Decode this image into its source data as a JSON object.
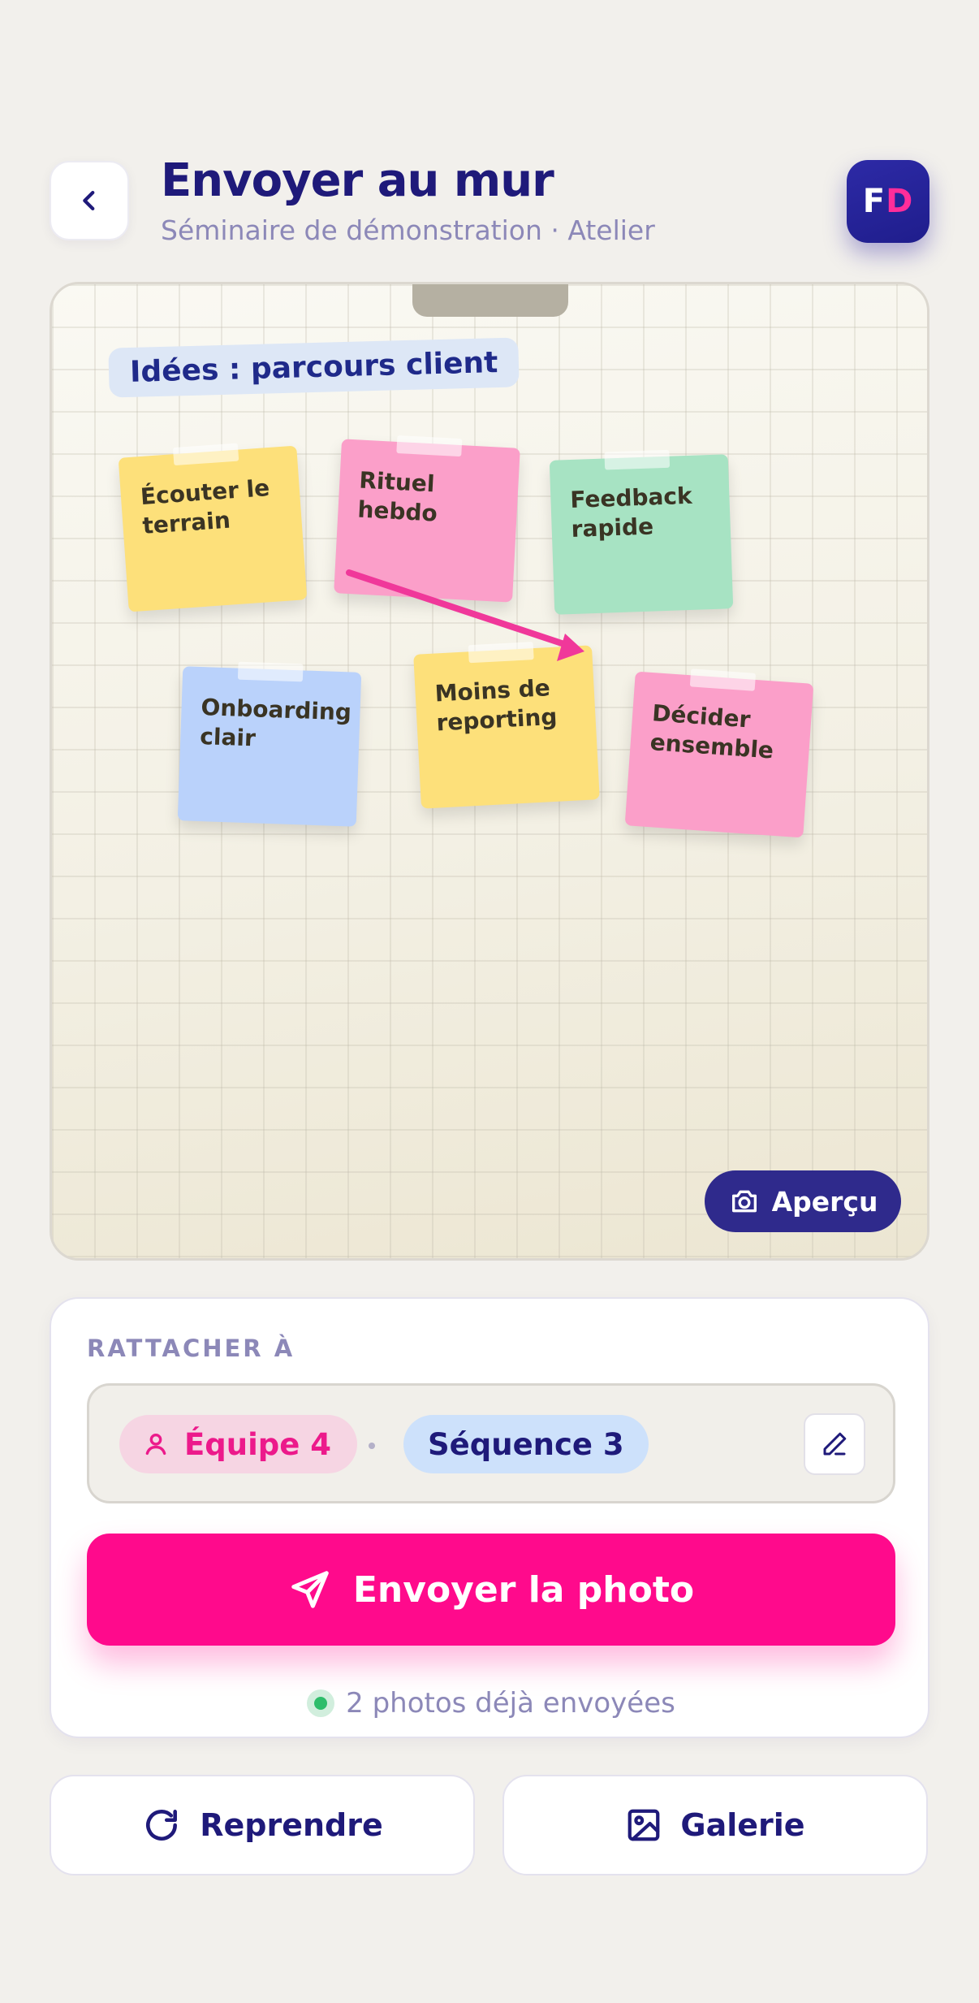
{
  "header": {
    "title": "Envoyer au mur",
    "subtitle": "Séminaire de démonstration · Atelier",
    "avatar_initials": {
      "first": "F",
      "second": "D"
    }
  },
  "photo": {
    "wall_title": "Idées : parcours client",
    "notes": [
      {
        "text": "Écouter le terrain",
        "color": "#fde07a"
      },
      {
        "text": "Rituel hebdo",
        "color": "#fb9fc9"
      },
      {
        "text": "Feedback rapide",
        "color": "#a7e3c3"
      },
      {
        "text": "Onboarding clair",
        "color": "#bad2fb"
      },
      {
        "text": "Moins de reporting",
        "color": "#fde07a"
      },
      {
        "text": "Décider ensemble",
        "color": "#fb9fc9"
      }
    ],
    "arrow_color": "#f0389a",
    "preview_label": "Aperçu"
  },
  "attach": {
    "label": "RATTACHER À",
    "team": "Équipe 4",
    "sequence": "Séquence 3",
    "send_label": "Envoyer la photo",
    "sent_status": "2 photos déjà envoyées"
  },
  "actions": {
    "retake_label": "Reprendre",
    "gallery_label": "Galerie"
  },
  "colors": {
    "accent": "#ff0a8c",
    "primary": "#1f1a7a",
    "background": "#f2f0ec",
    "success": "#2ebd6b"
  }
}
